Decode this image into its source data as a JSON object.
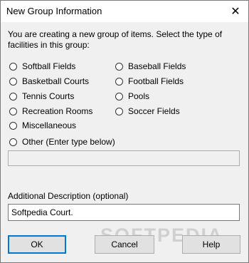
{
  "window": {
    "title": "New Group Information"
  },
  "intro": "You are creating a new group of items. Select the type of facilities in this group:",
  "options_left": [
    "Softball Fields",
    "Basketball Courts",
    "Tennis Courts",
    "Recreation Rooms",
    "Miscellaneous"
  ],
  "options_right": [
    "Baseball Fields",
    "Football Fields",
    "Pools",
    "Soccer Fields"
  ],
  "other_option": "Other (Enter type below)",
  "other_field": {
    "value": ""
  },
  "description": {
    "label": "Additional Description (optional)",
    "value": "Softpedia Court."
  },
  "buttons": {
    "ok": "OK",
    "cancel": "Cancel",
    "help": "Help"
  },
  "watermark": "SOFTPEDIA"
}
